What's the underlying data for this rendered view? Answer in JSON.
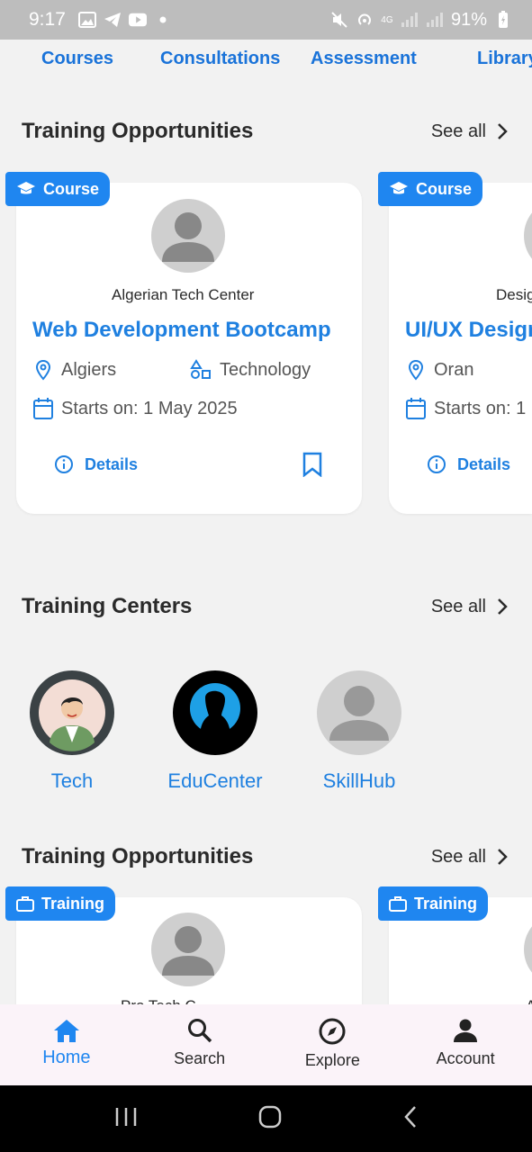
{
  "status_bar": {
    "time": "9:17",
    "battery": "91%",
    "network": "4G"
  },
  "categories": [
    "Courses",
    "Consultations",
    "Assessment",
    "Library"
  ],
  "section1": {
    "title": "Training Opportunities",
    "see_all": "See all"
  },
  "courses": [
    {
      "tag": "Course",
      "center": "Algerian Tech Center",
      "title": "Web Development Bootcamp",
      "location": "Algiers",
      "category": "Technology",
      "starts": "Starts on: 1 May 2025",
      "details": "Details"
    },
    {
      "tag": "Course",
      "center": "Desig",
      "title": "UI/UX Design",
      "location": "Oran",
      "starts": "Starts on: 1",
      "details": "Details"
    }
  ],
  "section2": {
    "title": "Training Centers",
    "see_all": "See all"
  },
  "centers": [
    {
      "name": "Tech"
    },
    {
      "name": "EduCenter"
    },
    {
      "name": "SkillHub"
    }
  ],
  "section3": {
    "title": "Training Opportunities",
    "see_all": "See all"
  },
  "trainings": [
    {
      "tag": "Training",
      "center": "Pro Tech C"
    },
    {
      "tag": "Training",
      "center": "A"
    }
  ],
  "bottom_nav": {
    "items": [
      {
        "label": "Home",
        "icon": "home-icon",
        "active": true
      },
      {
        "label": "Search",
        "icon": "search-icon",
        "active": false
      },
      {
        "label": "Explore",
        "icon": "compass-icon",
        "active": false
      },
      {
        "label": "Account",
        "icon": "person-icon",
        "active": false
      }
    ]
  },
  "colors": {
    "accent": "#1f86f0",
    "link": "#1f80e0",
    "background": "#f2f2f2"
  }
}
